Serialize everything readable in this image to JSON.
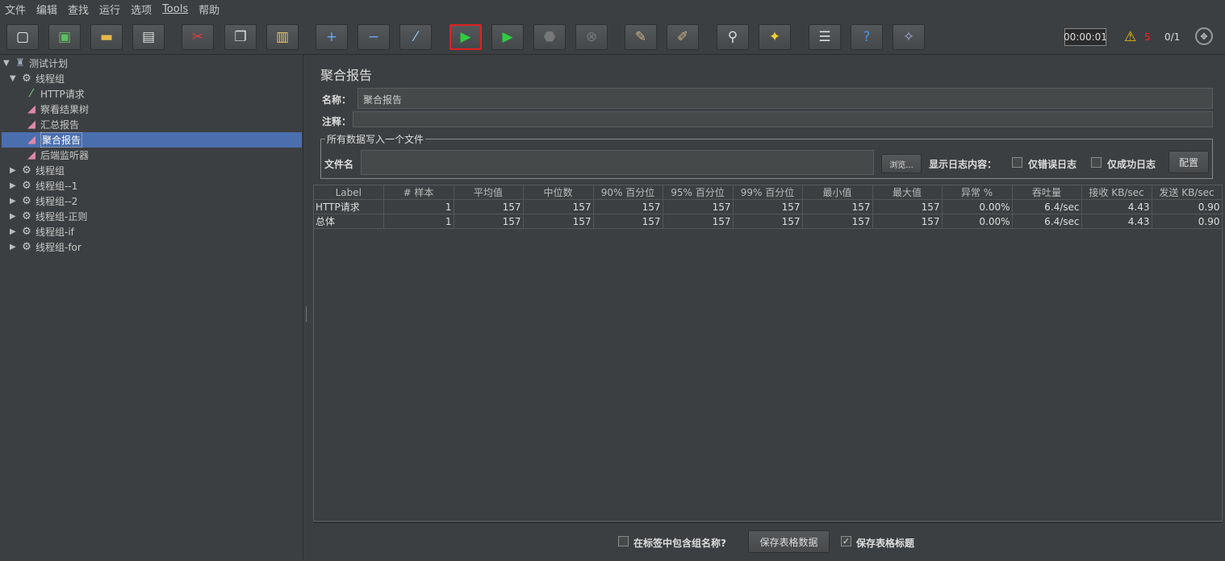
{
  "menu": [
    "文件",
    "编辑",
    "查找",
    "运行",
    "选项",
    "Tools",
    "帮助"
  ],
  "toolbar": {
    "run_annotation": "执行",
    "timer": "00:00:01",
    "warn_count": "5",
    "threads": "0/1",
    "icons": [
      "new-icon",
      "templates-icon",
      "open-icon",
      "save-icon",
      "cut-icon",
      "copy-icon",
      "paste-icon",
      "expand-icon",
      "collapse-icon",
      "toggle-icon",
      "start-icon",
      "start-no-pause-icon",
      "stop-icon",
      "shutdown-icon",
      "clear-icon",
      "clear-all-icon",
      "search-icon",
      "reset-search-icon",
      "function-helper-icon",
      "help-icon",
      "remote-icon"
    ],
    "run_highlight": "#e02020"
  },
  "tree": {
    "items": [
      {
        "label": "测试计划",
        "icon": "test-plan-icon",
        "toggle": "▼"
      },
      {
        "label": "线程组",
        "icon": "gear-icon",
        "toggle": "▼"
      },
      {
        "label": "HTTP请求",
        "icon": "pipette-icon",
        "toggle": ""
      },
      {
        "label": "察看结果树",
        "icon": "chart-icon",
        "toggle": ""
      },
      {
        "label": "汇总报告",
        "icon": "chart-icon",
        "toggle": ""
      },
      {
        "label": "聚合报告",
        "icon": "chart-icon",
        "toggle": ""
      },
      {
        "label": "后端监听器",
        "icon": "chart-icon",
        "toggle": ""
      },
      {
        "label": "线程组",
        "icon": "gear-icon",
        "toggle": "▶"
      },
      {
        "label": "线程组--1",
        "icon": "gear-icon",
        "toggle": "▶"
      },
      {
        "label": "线程组--2",
        "icon": "gear-icon",
        "toggle": "▶"
      },
      {
        "label": "线程组-正则",
        "icon": "gear-icon",
        "toggle": "▶"
      },
      {
        "label": "线程组-if",
        "icon": "gear-icon",
        "toggle": "▶"
      },
      {
        "label": "线程组-for",
        "icon": "gear-icon",
        "toggle": "▶"
      }
    ],
    "selected_index": 5
  },
  "panel": {
    "title": "聚合报告",
    "name_label": "名称：",
    "name_value": "聚合报告",
    "comment_label": "注释：",
    "comment_value": "",
    "file_section_title": "所有数据写入一个文件",
    "filename_label": "文件名",
    "filename_value": "",
    "browse_label": "浏览...",
    "log_label": "显示日志内容：",
    "errors_only_label": "仅错误日志",
    "success_only_label": "仅成功日志",
    "configure_label": "配置"
  },
  "table": {
    "headers": [
      "Label",
      "# 样本",
      "平均值",
      "中位数",
      "90% 百分位",
      "95% 百分位",
      "99% 百分位",
      "最小值",
      "最大值",
      "异常 %",
      "吞吐量",
      "接收 KB/sec",
      "发送 KB/sec"
    ],
    "rows": [
      [
        "HTTP请求",
        "1",
        "157",
        "157",
        "157",
        "157",
        "157",
        "157",
        "157",
        "0.00%",
        "6.4/sec",
        "4.43",
        "0.90"
      ],
      [
        "总体",
        "1",
        "157",
        "157",
        "157",
        "157",
        "157",
        "157",
        "157",
        "0.00%",
        "6.4/sec",
        "4.43",
        "0.90"
      ]
    ]
  },
  "footer": {
    "include_group_label": "在标签中包含组名称?",
    "include_group_checked": false,
    "save_data_label": "保存表格数据",
    "save_header_label": "保存表格标题",
    "save_header_checked": true
  }
}
